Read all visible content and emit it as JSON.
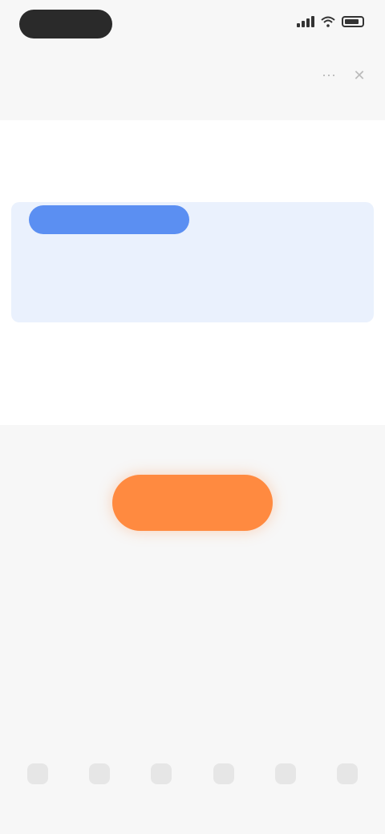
{
  "status_bar": {
    "time": "",
    "signal_bars": 4
  },
  "header": {
    "title": "",
    "icon_1": "ellipsis-icon",
    "icon_2": "close-icon"
  },
  "card": {
    "title": "",
    "badge": "",
    "plan_name": "",
    "plan_sub": "",
    "old_price": "",
    "price_note": "",
    "total_label": "",
    "total_sub": "",
    "total_value": ""
  },
  "cta": {
    "label": ""
  },
  "disclaimer": "",
  "section": {
    "title": ""
  },
  "features": [
    {
      "icon": "feature-icon",
      "label": ""
    },
    {
      "icon": "feature-icon",
      "label": ""
    },
    {
      "icon": "feature-icon",
      "label": ""
    },
    {
      "icon": "feature-icon",
      "label": ""
    },
    {
      "icon": "feature-icon",
      "label": ""
    },
    {
      "icon": "feature-icon",
      "label": ""
    }
  ],
  "colors": {
    "accent": "#ff8a40",
    "badge": "#5b8ff2",
    "strike_price": "#e5707a",
    "price_box": "#eaf1fd"
  }
}
